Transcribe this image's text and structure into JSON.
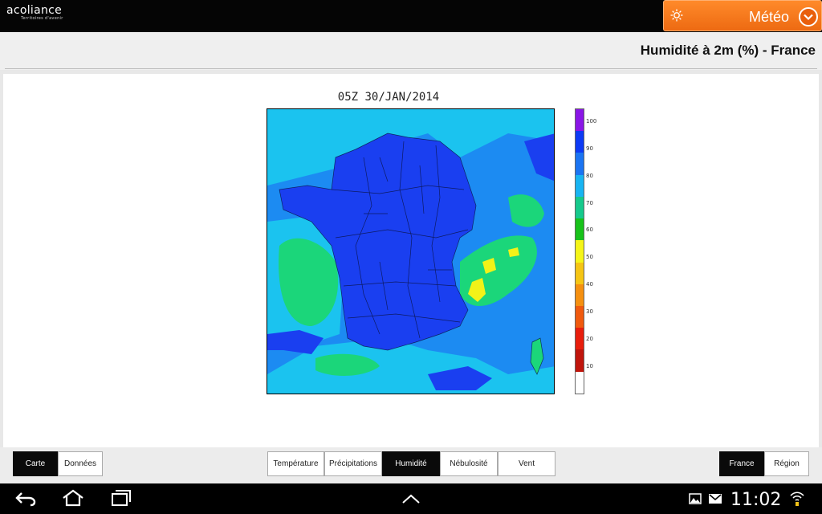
{
  "header": {
    "logo_text_main": "acoliance",
    "logo_text_sub": "Territoires d'avenir",
    "menu_label": "Météo"
  },
  "page": {
    "title": "Humidité à 2m (%) - France"
  },
  "map": {
    "timestamp": "05Z 30/JAN/2014",
    "legend": {
      "labels": [
        "100",
        "90",
        "80",
        "70",
        "60",
        "50",
        "40",
        "30",
        "20",
        "10"
      ],
      "colors": [
        "#8a16e6",
        "#0d3af5",
        "#1b74f2",
        "#18b4f2",
        "#16c98c",
        "#18c21a",
        "#f5f518",
        "#f5c514",
        "#f59010",
        "#f05a0e",
        "#e81e0c",
        "#c0150c",
        "#ffffff"
      ]
    },
    "colors": {
      "deep_blue": "#1a3ff0",
      "mid_blue": "#1c8bf2",
      "cyan": "#1bc3ef",
      "green": "#1bd67a",
      "yellow": "#f2f218"
    }
  },
  "toolbar": {
    "left": [
      {
        "label": "Carte",
        "active": true
      },
      {
        "label": "Données",
        "active": false
      }
    ],
    "center": [
      {
        "label": "Température",
        "active": false
      },
      {
        "label": "Précipitations",
        "active": false
      },
      {
        "label": "Humidité",
        "active": true
      },
      {
        "label": "Nébulosité",
        "active": false
      },
      {
        "label": "Vent",
        "active": false
      }
    ],
    "right": [
      {
        "label": "France",
        "active": true
      },
      {
        "label": "Région",
        "active": false
      }
    ]
  },
  "system": {
    "time": "11:02",
    "icons": [
      "back-icon",
      "home-icon",
      "recent-apps-icon",
      "up-chevron-icon",
      "gallery-icon",
      "gmail-icon",
      "wifi-icon"
    ]
  }
}
